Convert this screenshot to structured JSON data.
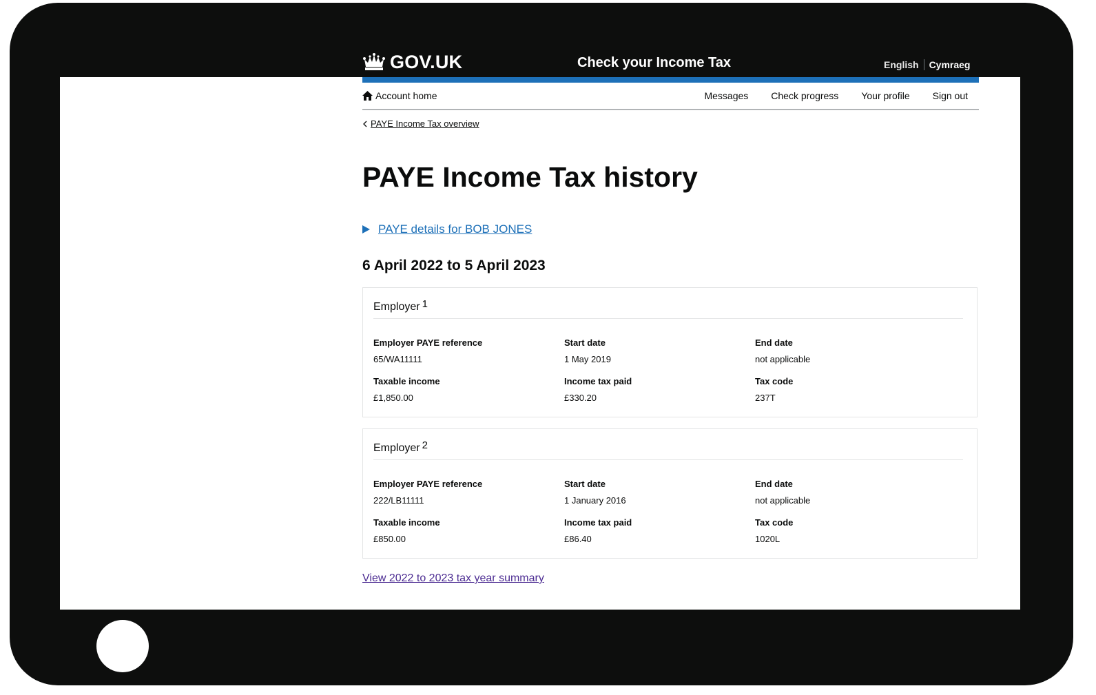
{
  "header": {
    "logo_text": "GOV.UK",
    "service_name": "Check your Income Tax",
    "languages": {
      "current": "English",
      "other": "Cymraeg"
    }
  },
  "account_nav": {
    "home_label": "Account home",
    "links": [
      "Messages",
      "Check progress",
      "Your profile",
      "Sign out"
    ]
  },
  "breadcrumb": {
    "back_label": "PAYE Income Tax overview"
  },
  "page": {
    "title": "PAYE Income Tax history",
    "details_label": "PAYE details for BOB JONES",
    "tax_year_heading": "6 April 2022 to 5 April 2023",
    "summary_link": "View 2022 to 2023 tax year summary"
  },
  "employers": [
    {
      "title": "Employer",
      "number": "1",
      "paye_ref_label": "Employer PAYE reference",
      "paye_ref": "65/WA11111",
      "start_label": "Start date",
      "start": "1 May 2019",
      "end_label": "End date",
      "end": "not applicable",
      "income_label": "Taxable income",
      "income": "£1,850.00",
      "tax_paid_label": "Income tax paid",
      "tax_paid": "£330.20",
      "code_label": "Tax code",
      "code": "237T"
    },
    {
      "title": "Employer",
      "number": "2",
      "paye_ref_label": "Employer PAYE reference",
      "paye_ref": "222/LB11111",
      "start_label": "Start date",
      "start": "1 January 2016",
      "end_label": "End date",
      "end": "not applicable",
      "income_label": "Taxable income",
      "income": "£850.00",
      "tax_paid_label": "Income tax paid",
      "tax_paid": "£86.40",
      "code_label": "Tax code",
      "code": "1020L"
    }
  ],
  "colors": {
    "link_blue": "#1d70b8",
    "visited_purple": "#4c2c92",
    "bar_blue": "#1d70b8",
    "frame": "#0d0e0d"
  }
}
